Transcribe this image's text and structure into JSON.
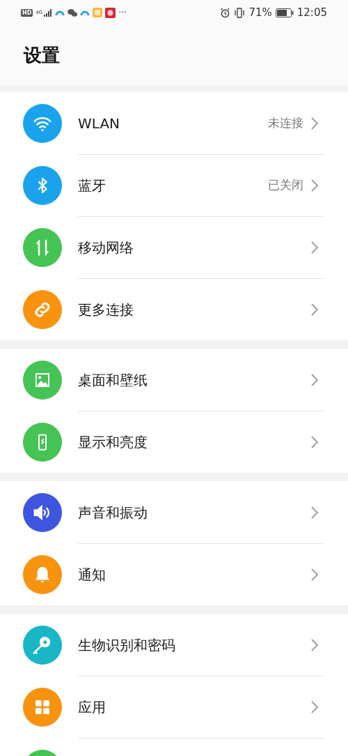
{
  "status_bar": {
    "hd": "HD",
    "network": "4G",
    "more": "···",
    "battery_percent": "71%",
    "time": "12:05"
  },
  "title": "设置",
  "groups": [
    {
      "items": [
        {
          "kind": "wifi",
          "color": "#1aa3ec",
          "label": "WLAN",
          "value": "未连接"
        },
        {
          "kind": "bluetooth",
          "color": "#1aa3ec",
          "label": "蓝牙",
          "value": "已关闭"
        },
        {
          "kind": "arrows",
          "color": "#45c354",
          "label": "移动网络"
        },
        {
          "kind": "link",
          "color": "#f7930f",
          "label": "更多连接"
        }
      ]
    },
    {
      "items": [
        {
          "kind": "image",
          "color": "#45c354",
          "label": "桌面和壁纸"
        },
        {
          "kind": "phone",
          "color": "#45c354",
          "label": "显示和亮度"
        }
      ]
    },
    {
      "items": [
        {
          "kind": "speaker",
          "color": "#3e55e0",
          "label": "声音和振动"
        },
        {
          "kind": "bell",
          "color": "#f7930f",
          "label": "通知"
        }
      ]
    },
    {
      "items": [
        {
          "kind": "key",
          "color": "#19b6c6",
          "label": "生物识别和密码"
        },
        {
          "kind": "grid",
          "color": "#f7930f",
          "label": "应用"
        },
        {
          "kind": "partial",
          "color": "#45c354"
        }
      ]
    }
  ]
}
